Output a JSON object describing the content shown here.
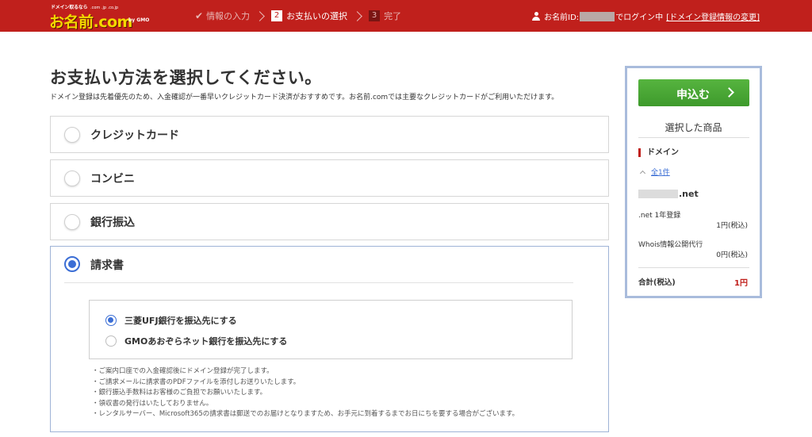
{
  "header": {
    "logo_tagline": "ドメイン取るなら",
    "logo_main": "お名前.com",
    "logo_domains": ".com .jp .co.jp",
    "logo_gmo": "by GMO",
    "steps": [
      {
        "label": "情報の入力",
        "num": "",
        "state": "done"
      },
      {
        "label": "お支払いの選択",
        "num": "2",
        "state": "current"
      },
      {
        "label": "完了",
        "num": "3",
        "state": "next"
      }
    ],
    "user_prefix": "お名前ID:",
    "user_suffix": "でログイン中",
    "change_link": "[ドメイン登録情報の変更]"
  },
  "main": {
    "title": "お支払い方法を選択してください。",
    "description": "ドメイン登録は先着優先のため、入金確認が一番早いクレジットカード決済がおすすめです。お名前.comでは主要なクレジットカードがご利用いただけます。",
    "options": [
      {
        "label": "クレジットカード",
        "selected": false
      },
      {
        "label": "コンビニ",
        "selected": false
      },
      {
        "label": "銀行振込",
        "selected": false
      },
      {
        "label": "請求書",
        "selected": true
      }
    ],
    "bank_options": [
      {
        "label": "三菱UFJ銀行を振込先にする",
        "selected": true
      },
      {
        "label": "GMOあおぞらネット銀行を振込先にする",
        "selected": false
      }
    ],
    "notes": [
      "ご案内口座での入金確認後にドメイン登録が完了します。",
      "ご請求メールに請求書のPDFファイルを添付しお送りいたします。",
      "銀行振込手数料はお客様のご負担でお願いいたします。",
      "領収書の発行はいたしておりません。",
      "レンタルサーバー、Microsoft365の請求書は郵送でのお届けとなりますため、お手元に到着するまでお日にちを要する場合がございます。"
    ]
  },
  "side": {
    "apply_label": "申込む",
    "selected_title": "選択した商品",
    "domain_heading": "ドメイン",
    "count_label": "全1件",
    "domain_suffix": ".net",
    "items": [
      {
        "name": ".net 1年登録",
        "price": "1円(税込)"
      },
      {
        "name": "Whois情報公開代行",
        "price": "0円(税込)"
      }
    ],
    "total_label": "合計(税込)",
    "total_value": "1円"
  },
  "colors": {
    "brand_red": "#c0201c",
    "accent_blue": "#3b6ed5",
    "apply_green": "#4caf38",
    "panel_border": "#a9bcdc"
  }
}
